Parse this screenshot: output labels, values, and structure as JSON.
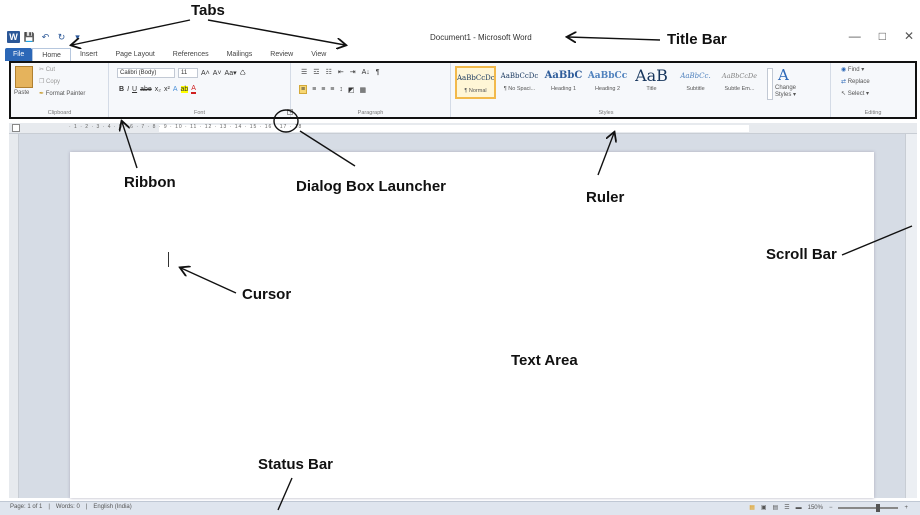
{
  "window": {
    "title": "Document1 - Microsoft Word",
    "quick_access": [
      "word-icon",
      "save-icon",
      "undo-icon",
      "redo-icon",
      "customize-icon"
    ],
    "controls": [
      "—",
      "□",
      "✕"
    ]
  },
  "tabs": [
    "File",
    "Home",
    "Insert",
    "Page Layout",
    "References",
    "Mailings",
    "Review",
    "View"
  ],
  "ribbon": {
    "clipboard": {
      "label": "Clipboard",
      "paste": "Paste",
      "cut": "Cut",
      "copy": "Copy",
      "format_painter": "Format Painter"
    },
    "font": {
      "label": "Font",
      "font_name": "Calibri (Body)",
      "font_size": "11",
      "grow": "A˄",
      "shrink": "A˅",
      "change_case": "Aa▾",
      "clear": "♺",
      "bold": "B",
      "italic": "I",
      "underline": "U",
      "strike": "abe",
      "subscript": "x₂",
      "superscript": "x²",
      "text_effects": "A",
      "highlight": "ab",
      "font_color": "A"
    },
    "paragraph": {
      "label": "Paragraph",
      "bullets": "☰",
      "numbering": "☲",
      "multilevel": "☷",
      "decrease_indent": "⇤",
      "increase_indent": "⇥",
      "sort": "A↓",
      "show_marks": "¶",
      "align_left": "≡",
      "center": "≡",
      "align_right": "≡",
      "justify": "≡",
      "line_spacing": "↕",
      "shading": "◩",
      "borders": "▦"
    },
    "styles": {
      "label": "Styles",
      "items": [
        {
          "preview": "AaBbCcDc",
          "name": "¶ Normal"
        },
        {
          "preview": "AaBbCcDc",
          "name": "¶ No Spaci..."
        },
        {
          "preview": "AaBbC",
          "name": "Heading 1"
        },
        {
          "preview": "AaBbCc",
          "name": "Heading 2"
        },
        {
          "preview": "AaB",
          "name": "Title"
        },
        {
          "preview": "AaBbCc.",
          "name": "Subtitle"
        },
        {
          "preview": "AaBbCcDe",
          "name": "Subtle Em..."
        }
      ],
      "change_styles": "Change Styles ▾"
    },
    "editing": {
      "label": "Editing",
      "find": "Find ▾",
      "replace": "Replace",
      "select": "Select ▾"
    }
  },
  "ruler": {
    "ticks": "· 1 · 2 · 3 · 4 · 5 · 6 · 7 · 8 · 9 · 10 · 11 · 12 · 13 · 14 · 15 · 16 · 17 · 18"
  },
  "status": {
    "page": "Page: 1 of 1",
    "words": "Words: 0",
    "language": "English (India)",
    "zoom": "150%",
    "zoom_out": "−",
    "zoom_in": "+"
  },
  "annotations": {
    "tabs": "Tabs",
    "title_bar": "Title Bar",
    "ribbon": "Ribbon",
    "dialog_box_launcher": "Dialog Box Launcher",
    "ruler": "Ruler",
    "scroll_bar": "Scroll Bar",
    "cursor": "Cursor",
    "text_area": "Text Area",
    "status_bar": "Status Bar"
  }
}
